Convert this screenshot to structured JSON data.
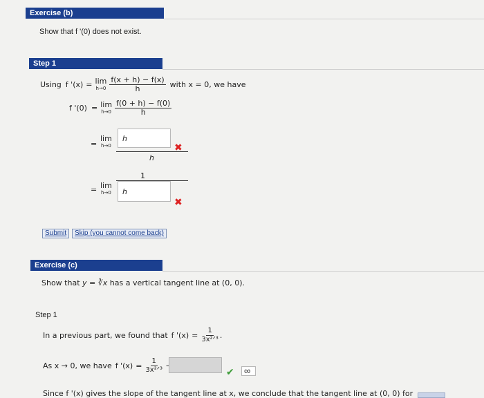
{
  "exercise_b": {
    "header": "Exercise (b)",
    "prompt": "Show that f '(0) does not exist.",
    "step_header": "Step 1",
    "using_label": "Using",
    "fprime_x": "f '(x)",
    "eq": "=",
    "lim": "lim",
    "lim_sub": "h→0",
    "def_num": "f(x + h) − f(x)",
    "def_den": "h",
    "with_text": "with x = 0, we have",
    "fprime_0": "f '(0)",
    "zero_num": "f(0 + h) − f(0)",
    "zero_den": "h",
    "answer1_value": "h",
    "answer1_den": "h",
    "answer2_num": "1",
    "answer2_value": "h",
    "submit_label": "Submit",
    "skip_label": "Skip (you cannot come back)"
  },
  "exercise_c": {
    "header": "Exercise (c)",
    "prompt_prefix": "Show that",
    "prompt_expr": "y = ∛x",
    "prompt_suffix": "has a vertical tangent line at (0, 0).",
    "step_label": "Step 1",
    "previous_text": "In a previous part, we found that",
    "fprime_x": "f '(x)",
    "eq": "=",
    "frac_num": "1",
    "frac_den": "3x²ᐟ³",
    "period": ".",
    "as_text": "As x → 0, we have",
    "arrow": "→",
    "inf_input": "∞",
    "inf_answer": "∞",
    "since_text": "Since f '(x) gives the slope of the tangent line at x, we conclude that the tangent line at (0, 0) for"
  },
  "colors": {
    "header_bg": "#1b3f8f",
    "wrong": "#d22222",
    "correct": "#3a9a35"
  }
}
